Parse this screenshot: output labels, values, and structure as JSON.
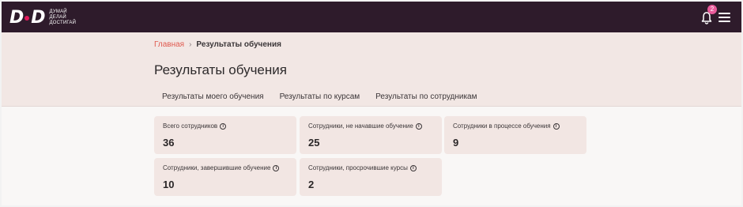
{
  "brand": {
    "mark": "DD",
    "tagline": [
      "ДУМАЙ",
      "ДЕЛАЙ",
      "ДОСТИГАЙ"
    ]
  },
  "header": {
    "notifications_count": "2"
  },
  "breadcrumb": {
    "home": "Главная",
    "separator": "›",
    "current": "Результаты обучения"
  },
  "page": {
    "title": "Результаты обучения"
  },
  "tabs": [
    {
      "label": "Результаты моего обучения",
      "active": false
    },
    {
      "label": "Результаты по курсам",
      "active": false
    },
    {
      "label": "Результаты по сотрудникам",
      "active": true
    }
  ],
  "stats": [
    {
      "label": "Всего сотрудников",
      "value": "36"
    },
    {
      "label": "Сотрудники, не начавшие обучение",
      "value": "25"
    },
    {
      "label": "Сотрудники в процессе обучения",
      "value": "9"
    },
    {
      "label": "Сотрудники, завершившие обучение",
      "value": "10"
    },
    {
      "label": "Сотрудники, просрочившие курсы",
      "value": "2"
    }
  ],
  "colors": {
    "topbar": "#2e1b2b",
    "accent": "#e3195c",
    "badge": "#e95a9a",
    "hero": "#f2e7e4",
    "card": "#f2e6e3",
    "breadcrumb_link": "#e05a4f"
  },
  "icons": {
    "notifications": "bell-icon",
    "menu": "hamburger-icon",
    "info": "info-icon"
  }
}
